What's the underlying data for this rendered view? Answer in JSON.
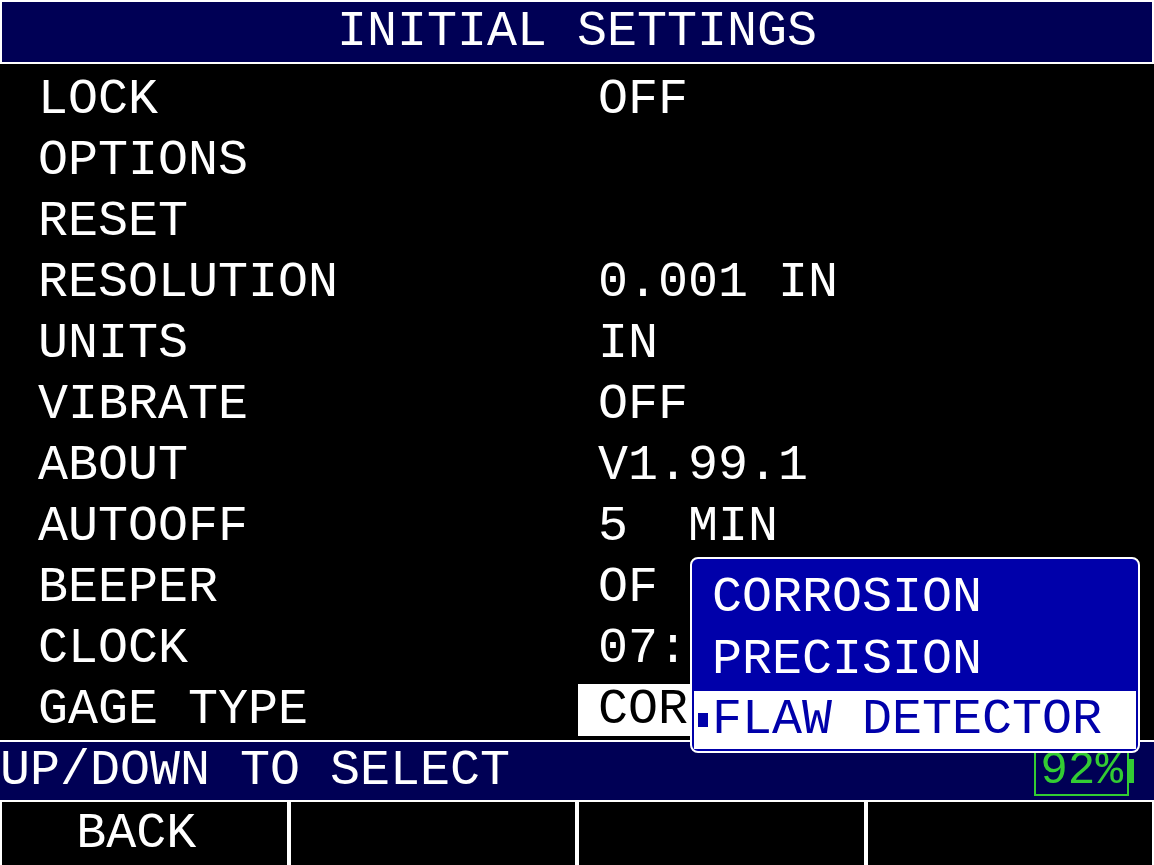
{
  "title": "INITIAL SETTINGS",
  "settings": [
    {
      "label": "LOCK",
      "value": "OFF",
      "selected": false
    },
    {
      "label": "OPTIONS",
      "selected": false
    },
    {
      "label": "RESET",
      "selected": false
    },
    {
      "label": "RESOLUTION",
      "value": "0.001 IN",
      "selected": false
    },
    {
      "label": "UNITS",
      "value": "IN",
      "selected": false
    },
    {
      "label": "VIBRATE",
      "value": "OFF",
      "selected": false
    },
    {
      "label": "ABOUT",
      "value": "V1.99.1",
      "selected": false
    },
    {
      "label": "AUTOOFF",
      "value": "5  MIN",
      "selected": false
    },
    {
      "label": "BEEPER",
      "value": "OF",
      "selected": false
    },
    {
      "label": "CLOCK",
      "value": "07:",
      "selected": false
    },
    {
      "label": "GAGE TYPE",
      "value": "COR",
      "selected": true
    }
  ],
  "dropdown": {
    "options": [
      {
        "label": "CORROSION",
        "selected": false
      },
      {
        "label": "PRECISION",
        "selected": false
      },
      {
        "label": "FLAW DETECTOR",
        "selected": true
      }
    ]
  },
  "status_bar": {
    "hint": "UP/DOWN TO SELECT",
    "battery": "92%"
  },
  "softkeys": [
    "BACK"
  ]
}
